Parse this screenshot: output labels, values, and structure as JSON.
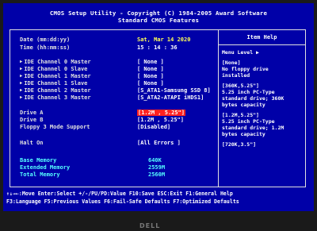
{
  "header": {
    "title_line": "CMOS Setup Utility - Copyright (C) 1984-2005 Award Software",
    "subtitle": "Standard CMOS Features"
  },
  "settings": {
    "date_label": "Date (mm:dd:yy)",
    "date_value": "Sat, Mar 14 2020",
    "time_label": "Time (hh:mm:ss)",
    "time_value": "15 : 14 : 36",
    "ide": [
      {
        "label": "IDE Channel 0 Master",
        "value": "[ None ]"
      },
      {
        "label": "IDE Channel 0 Slave",
        "value": "[ None ]"
      },
      {
        "label": "IDE Channel 1 Master",
        "value": "[ None ]"
      },
      {
        "label": "IDE Channel 1 Slave",
        "value": "[ None ]"
      },
      {
        "label": "IDE Channel 2 Master",
        "value": "[S_ATA1-Samsung SSD 8]"
      },
      {
        "label": "IDE Channel 3 Master",
        "value": "[S_ATA2-ATAPI  iHDS1]"
      }
    ],
    "drive_a_label": "Drive A",
    "drive_a_value": "[1.2M , 5.25\"]",
    "drive_b_label": "Drive B",
    "drive_b_value": "[1.2M , 5.25\"]",
    "floppy3_label": "Floppy 3 Mode Support",
    "floppy3_value": "[Disabled]",
    "halt_label": "Halt On",
    "halt_value": "[All Errors    ]",
    "base_mem_label": "Base Memory",
    "base_mem_value": "640K",
    "ext_mem_label": "Extended Memory",
    "ext_mem_value": "2559M",
    "total_mem_label": "Total Memory",
    "total_mem_value": "2560M"
  },
  "help": {
    "title": "Item Help",
    "menu_level": "Menu Level   ▶",
    "lines": [
      "[None]",
      "No floppy drive",
      "installed",
      "",
      "[360K,5.25\"]",
      "5.25 inch PC-Type",
      "standard drive; 360K",
      "bytes capacity",
      "",
      "[1.2M,5.25\"]",
      "5.25 inch PC-Type",
      "standard drive; 1.2M",
      "bytes capacity",
      "",
      "[720K,3.5\"]"
    ]
  },
  "footer": {
    "line1": "↑↓→←:Move  Enter:Select  +/-/PU/PD:Value  F10:Save  ESC:Exit  F1:General Help",
    "line2": "F3:Language  F5:Previous Values  F6:Fail-Safe Defaults  F7:Optimized Defaults"
  },
  "bezel": {
    "brand": "DELL"
  },
  "colors": {
    "background": "#0000a8",
    "label": "#e0e0e0",
    "value_yellow": "#ffff55",
    "highlight": "#ff2020",
    "memory": "#55ffff"
  }
}
